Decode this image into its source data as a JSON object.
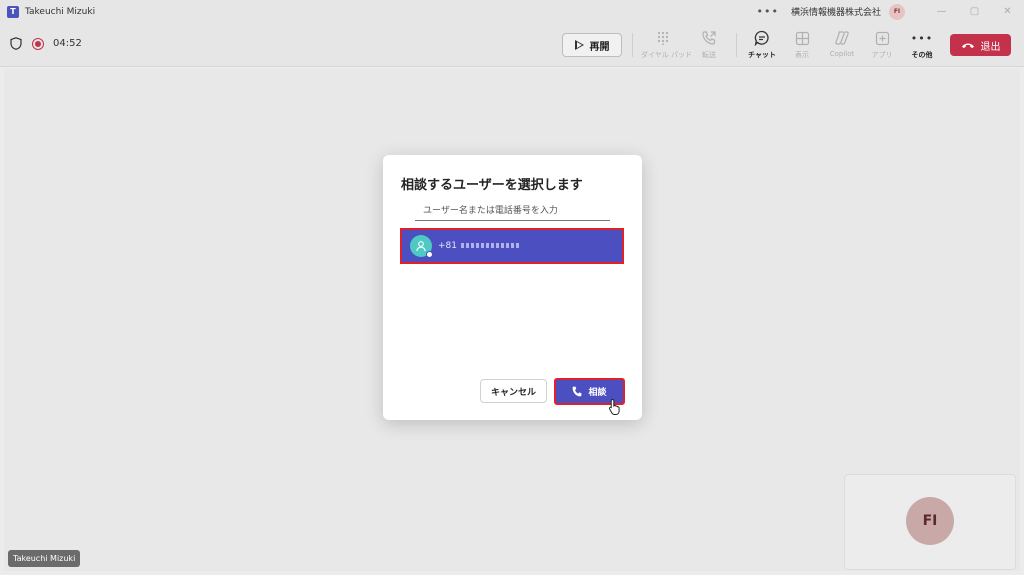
{
  "window": {
    "title": "Takeuchi Mizuki",
    "more": "•••",
    "org": "横浜情報機器株式会社",
    "avatar_initials": "FI",
    "minimize": "—",
    "maximize": "▢",
    "close": "✕"
  },
  "toolbar": {
    "timer": "04:52",
    "resume_label": "再開",
    "items": [
      {
        "label": "ダイヤル パッド",
        "icon": "dialpad-icon",
        "enabled": false
      },
      {
        "label": "転送",
        "icon": "transfer-icon",
        "enabled": false
      },
      {
        "label": "チャット",
        "icon": "chat-icon",
        "enabled": true
      },
      {
        "label": "表示",
        "icon": "view-icon",
        "enabled": false
      },
      {
        "label": "Copilot",
        "icon": "copilot-icon",
        "enabled": false
      },
      {
        "label": "アプリ",
        "icon": "apps-icon",
        "enabled": false
      },
      {
        "label": "その他",
        "icon": "more-icon",
        "enabled": true
      }
    ],
    "more_dots": "•••",
    "leave_label": "退出"
  },
  "dialog": {
    "title": "相談するユーザーを選択します",
    "search_placeholder": "ユーザー名または電話番号を入力",
    "result_prefix": "+81",
    "cancel_label": "キャンセル",
    "consult_label": "相談"
  },
  "stage": {
    "self_initials": "FI",
    "name_tag": "Takeuchi Mizuki"
  },
  "colors": {
    "accent": "#4b4fbf",
    "leave": "#c4314b",
    "highlight": "#e0202a"
  }
}
